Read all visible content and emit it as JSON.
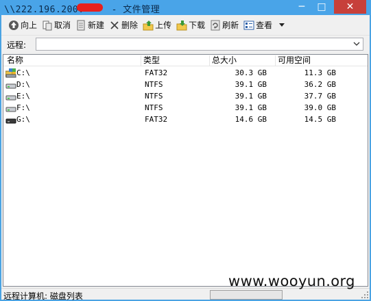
{
  "window": {
    "title_prefix": "\\\\222.196.200.",
    "title_suffix": "- 文件管理",
    "minimize_symbol": "─",
    "maximize_symbol": "□",
    "close_symbol": "✕"
  },
  "toolbar": {
    "up_label": "向上",
    "cancel_label": "取消",
    "new_label": "新建",
    "delete_label": "删除",
    "upload_label": "上传",
    "download_label": "下载",
    "refresh_label": "刷新",
    "view_label": "查看"
  },
  "address": {
    "label": "远程:",
    "value": ""
  },
  "list": {
    "columns": [
      "名称",
      "类型",
      "总大小",
      "可用空间"
    ],
    "rows": [
      {
        "name": "C:\\",
        "type": "FAT32",
        "total": "30.3 GB",
        "free": "11.3 GB",
        "icon": "system-drive-icon"
      },
      {
        "name": "D:\\",
        "type": "NTFS",
        "total": "39.1 GB",
        "free": "36.2 GB",
        "icon": "hard-drive-icon"
      },
      {
        "name": "E:\\",
        "type": "NTFS",
        "total": "39.1 GB",
        "free": "37.7 GB",
        "icon": "hard-drive-icon"
      },
      {
        "name": "F:\\",
        "type": "NTFS",
        "total": "39.1 GB",
        "free": "39.0 GB",
        "icon": "hard-drive-icon"
      },
      {
        "name": "G:\\",
        "type": "FAT32",
        "total": "14.6 GB",
        "free": "14.5 GB",
        "icon": "removable-drive-icon"
      }
    ]
  },
  "status": {
    "text": "远程计算机: 磁盘列表"
  },
  "watermark": "www.wooyun.org",
  "colors": {
    "titlebar": "#49a4e8",
    "close_button": "#c7403a",
    "redaction": "#e8201d"
  }
}
